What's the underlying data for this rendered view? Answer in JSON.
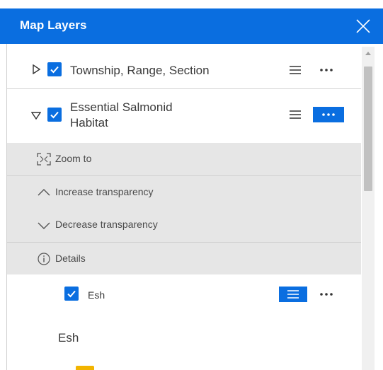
{
  "header": {
    "title": "Map Layers",
    "close_icon": "close-icon",
    "background": "#0a6ee0"
  },
  "layers": [
    {
      "label": "Township, Range, Section",
      "checked": true,
      "expanded": false
    },
    {
      "label_line1": "Essential Salmonid",
      "label_line2": "Habitat",
      "checked": true,
      "expanded": true
    }
  ],
  "action_menu": {
    "items": [
      {
        "label": "Zoom to",
        "icon": "zoom-to-icon"
      },
      {
        "label": "Increase transparency",
        "icon": "chevron-up-icon"
      },
      {
        "label": "Decrease transparency",
        "icon": "chevron-down-icon"
      },
      {
        "label": "Details",
        "icon": "info-icon"
      }
    ]
  },
  "sublayer": {
    "label": "Esh",
    "checked": true
  },
  "legend": {
    "title": "Esh",
    "swatch_color": "#f2b400"
  },
  "colors": {
    "accent": "#0a6ee0",
    "menu_bg": "#e6e6e6"
  }
}
